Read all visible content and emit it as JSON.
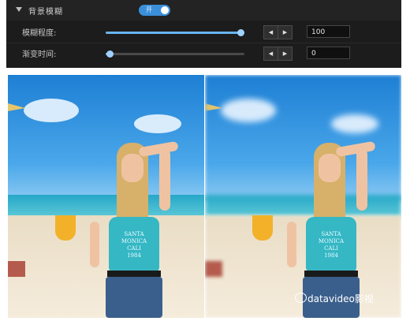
{
  "panel": {
    "header": {
      "label": "背景模糊",
      "toggle_label": "开"
    },
    "rows": [
      {
        "label": "模糊程度:",
        "value": "100",
        "slider_fraction": 0.97
      },
      {
        "label": "渐变时间:",
        "value": "0",
        "slider_fraction": 0.03
      }
    ],
    "stepper": {
      "decrease": "◀",
      "increase": "▶"
    }
  },
  "comparison": {
    "left_image": "beach-portrait-original",
    "right_image": "beach-portrait-blurred",
    "shirt_text": [
      "SANTA MONICA",
      "CALI",
      "1984"
    ]
  },
  "watermark": {
    "text": "datavideo影视"
  },
  "colors": {
    "accent": "#3b8fd9",
    "panel_bg": "#1c1c1c"
  }
}
